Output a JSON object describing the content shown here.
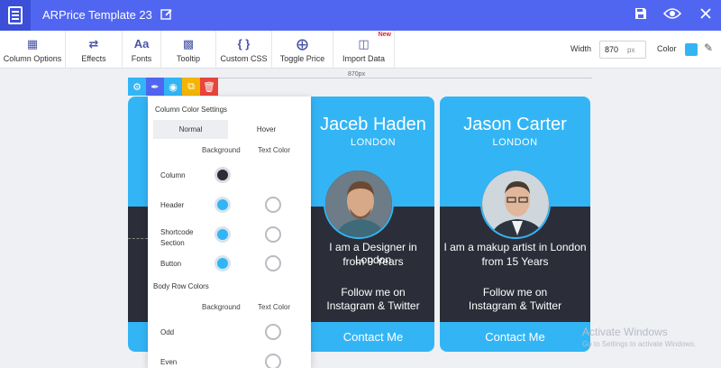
{
  "app": {
    "title": "ARPrice Template 23"
  },
  "toolbar": {
    "items": [
      {
        "label": "Column Options",
        "icon": "column-options-icon"
      },
      {
        "label": "Effects",
        "icon": "shuffle-icon"
      },
      {
        "label": "Fonts",
        "icon": "fonts-icon"
      },
      {
        "label": "Tooltip",
        "icon": "tooltip-icon"
      },
      {
        "label": "Custom CSS",
        "icon": "braces-icon"
      },
      {
        "label": "Toggle Price",
        "icon": "toggle-icon"
      },
      {
        "label": "Import Data",
        "icon": "import-icon",
        "badge": "New"
      }
    ],
    "width_label": "Width",
    "width_value": "870",
    "width_unit": "px",
    "color_label": "Color",
    "color_value": "#33b5f5"
  },
  "canvas": {
    "width_marker": "870px"
  },
  "panel": {
    "title": "Column Color Settings",
    "tabs": [
      "Normal",
      "Hover"
    ],
    "col_background": "Background",
    "col_text": "Text Color",
    "rows": [
      {
        "label": "Column"
      },
      {
        "label": "Header"
      },
      {
        "label": "Shortcode Section"
      },
      {
        "label": "Button"
      }
    ],
    "body_title": "Body Row Colors",
    "body_rows": [
      {
        "label": "Odd"
      },
      {
        "label": "Even"
      }
    ]
  },
  "cards": [
    {
      "name": "Jaceb Haden",
      "city": "LONDON",
      "line1": "I am a Designer in London",
      "line2": "from 9 Years",
      "line3": "Follow me on",
      "line4": "Instagram & Twitter",
      "button": "Contact Me"
    },
    {
      "name": "Jason Carter",
      "city": "LONDON",
      "line1": "I am a makup artist in London",
      "line2": "from 15 Years",
      "line3": "Follow me on",
      "line4": "Instagram & Twitter",
      "button": "Contact Me"
    }
  ],
  "watermark": {
    "line1": "Activate Windows",
    "line2": "Go to Settings to activate Windows."
  },
  "colors": {
    "accent": "#5166f0",
    "card_blue": "#33b5f5",
    "card_dark": "#2b2e38"
  }
}
